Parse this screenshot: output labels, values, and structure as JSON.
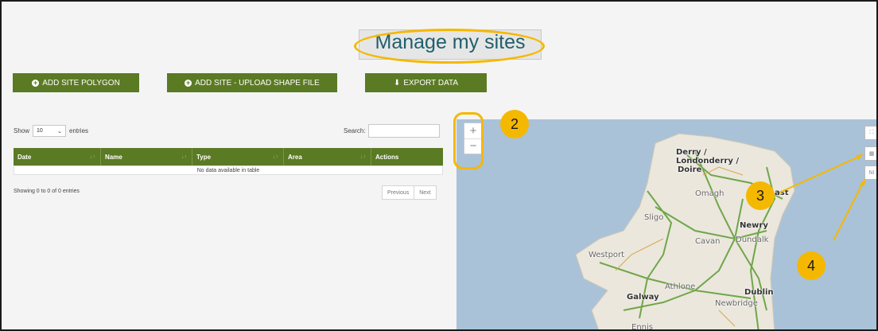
{
  "page": {
    "title": "Manage my sites"
  },
  "buttons": {
    "add_polygon": "ADD SITE POLYGON",
    "upload_shape": "ADD SITE - UPLOAD SHAPE FILE",
    "export_data": "EXPORT DATA"
  },
  "table": {
    "show_label": "Show",
    "entries_value": "10",
    "entries_label": "entries",
    "search_label": "Search:",
    "columns": [
      "Date",
      "Name",
      "Type",
      "Area",
      "Actions"
    ],
    "empty_message": "No data available in table",
    "info": "Showing 0 to 0 of 0 entries",
    "previous": "Previous",
    "next": "Next"
  },
  "map": {
    "zoom_in": "+",
    "zoom_out": "−",
    "controls": [
      "⛶",
      "▦",
      "NI"
    ],
    "places": [
      "Derry /",
      "Londonderry /",
      "Doire",
      "Omagh",
      "Sligo",
      "Newry",
      "Cavan",
      "Dundalk",
      "Westport",
      "Athlone",
      "Galway",
      "Dublin",
      "Newbridge",
      "Ennis",
      "ast"
    ]
  },
  "markers": [
    "2",
    "3",
    "4"
  ],
  "colors": {
    "accent_green": "#5b7a24",
    "highlight": "#f5b800",
    "title_text": "#1f5f6c",
    "sea": "#a9c2d8"
  }
}
